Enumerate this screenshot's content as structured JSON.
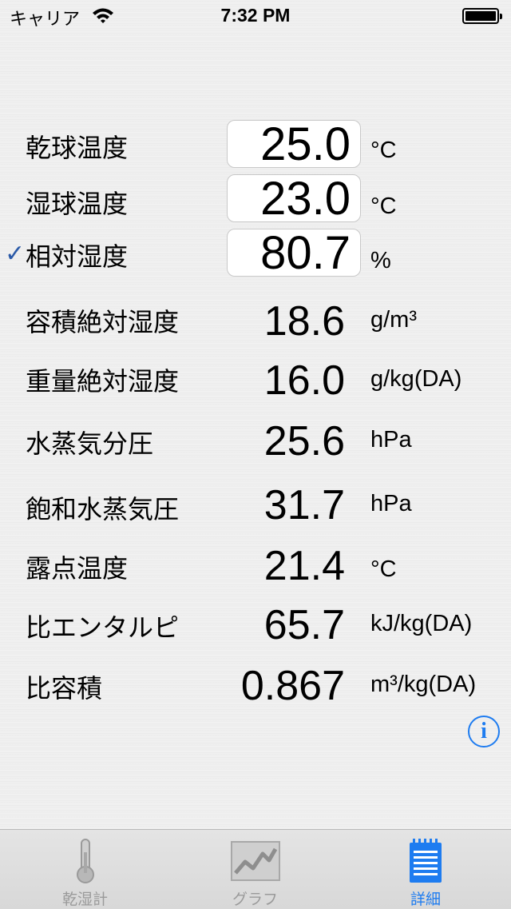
{
  "status_bar": {
    "carrier": "キャリア",
    "time": "7:32 PM"
  },
  "inputs": [
    {
      "label": "乾球温度",
      "value": "25.0",
      "unit": "°C",
      "checked": false
    },
    {
      "label": "湿球温度",
      "value": "23.0",
      "unit": "°C",
      "checked": false
    },
    {
      "label": "相対湿度",
      "value": "80.7",
      "unit": "%",
      "checked": true
    }
  ],
  "check_mark": "✓",
  "results": [
    {
      "label": "容積絶対湿度",
      "value": "18.6",
      "unit": "g/m³"
    },
    {
      "label": "重量絶対湿度",
      "value": "16.0",
      "unit": "g/kg(DA)"
    },
    {
      "label": "水蒸気分圧",
      "value": "25.6",
      "unit": "hPa"
    },
    {
      "label": "飽和水蒸気圧",
      "value": "31.7",
      "unit": "hPa"
    },
    {
      "label": "露点温度",
      "value": "21.4",
      "unit": "°C"
    },
    {
      "label": "比エンタルピ",
      "value": "65.7",
      "unit": "kJ/kg(DA)"
    },
    {
      "label": "比容積",
      "value": "0.867",
      "unit": "m³/kg(DA)"
    }
  ],
  "info_button": {
    "glyph": "i"
  },
  "tabs": [
    {
      "label": "乾湿計",
      "icon": "thermometer-icon",
      "active": false
    },
    {
      "label": "グラフ",
      "icon": "graph-icon",
      "active": false
    },
    {
      "label": "詳細",
      "icon": "notepad-icon",
      "active": true
    }
  ],
  "colors": {
    "accent": "#1e7cf0",
    "check": "#2b5aa8",
    "inactive_tab": "#9a9a9a"
  }
}
